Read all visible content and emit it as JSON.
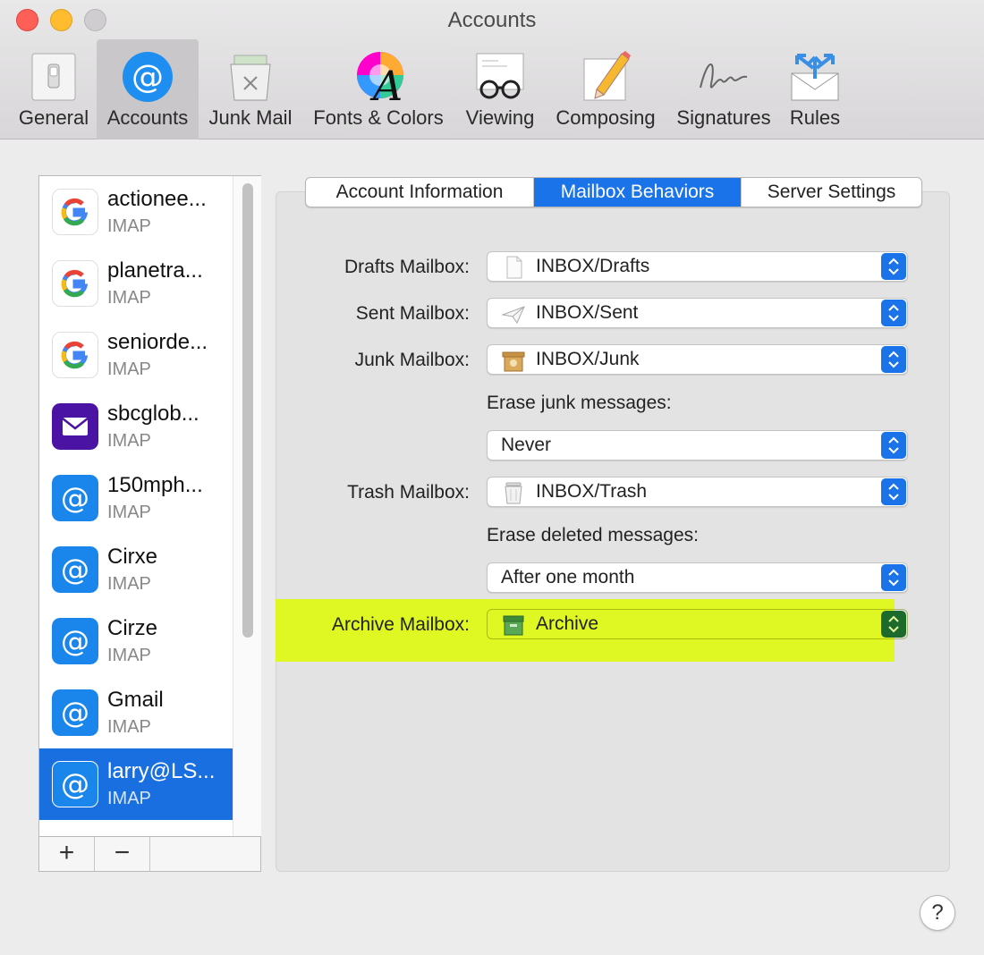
{
  "window": {
    "title": "Accounts"
  },
  "toolbar": {
    "items": [
      {
        "label": "General",
        "icon": "general-switch-icon"
      },
      {
        "label": "Accounts",
        "icon": "at-sign-icon",
        "active": true
      },
      {
        "label": "Junk Mail",
        "icon": "junk-trash-icon"
      },
      {
        "label": "Fonts & Colors",
        "icon": "fonts-colors-icon"
      },
      {
        "label": "Viewing",
        "icon": "glasses-icon"
      },
      {
        "label": "Composing",
        "icon": "pencil-paper-icon"
      },
      {
        "label": "Signatures",
        "icon": "signature-icon"
      },
      {
        "label": "Rules",
        "icon": "rules-envelope-icon"
      }
    ]
  },
  "accounts": [
    {
      "name": "actionee...",
      "type": "IMAP",
      "icon": "google-icon"
    },
    {
      "name": "planetra...",
      "type": "IMAP",
      "icon": "google-icon"
    },
    {
      "name": "seniorde...",
      "type": "IMAP",
      "icon": "google-icon"
    },
    {
      "name": "sbcglob...",
      "type": "IMAP",
      "icon": "yahoo-mail-icon"
    },
    {
      "name": "150mph...",
      "type": "IMAP",
      "icon": "at-sign-icon"
    },
    {
      "name": "Cirxe",
      "type": "IMAP",
      "icon": "at-sign-icon"
    },
    {
      "name": "Cirze",
      "type": "IMAP",
      "icon": "at-sign-icon"
    },
    {
      "name": "Gmail",
      "type": "IMAP",
      "icon": "at-sign-icon"
    },
    {
      "name": "larry@LS...",
      "type": "IMAP",
      "icon": "at-sign-icon",
      "selected": true
    }
  ],
  "account_footer": {
    "add": "+",
    "remove": "−"
  },
  "tabs": [
    {
      "label": "Account Information"
    },
    {
      "label": "Mailbox Behaviors",
      "active": true
    },
    {
      "label": "Server Settings"
    }
  ],
  "mailbox": {
    "drafts_label": "Drafts Mailbox:",
    "drafts_value": "INBOX/Drafts",
    "sent_label": "Sent Mailbox:",
    "sent_value": "INBOX/Sent",
    "junk_label": "Junk Mailbox:",
    "junk_value": "INBOX/Junk",
    "erase_junk_label": "Erase junk messages:",
    "erase_junk_value": "Never",
    "trash_label": "Trash Mailbox:",
    "trash_value": "INBOX/Trash",
    "erase_deleted_label": "Erase deleted messages:",
    "erase_deleted_value": "After one month",
    "archive_label": "Archive Mailbox:",
    "archive_value": "Archive"
  },
  "help": "?",
  "colors": {
    "accent": "#1a73e8",
    "selection": "#1a6fe0",
    "highlight": "#defa00"
  }
}
